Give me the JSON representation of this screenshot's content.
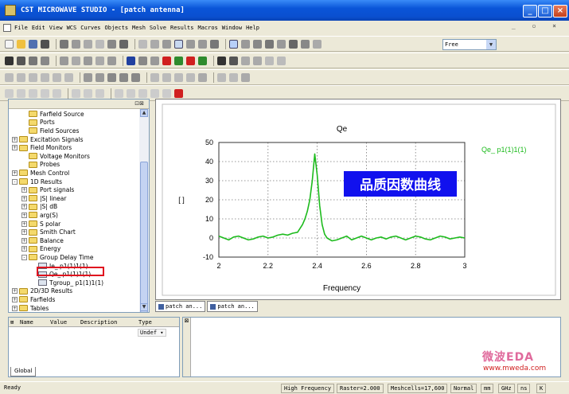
{
  "window": {
    "title": "CST MICROWAVE STUDIO - [patch antenna]"
  },
  "menu": [
    "File",
    "Edit",
    "View",
    "WCS",
    "Curves",
    "Objects",
    "Mesh",
    "Solve",
    "Results",
    "Macros",
    "Window",
    "Help"
  ],
  "toolbar": {
    "solver_select": "Free"
  },
  "tree": {
    "items": [
      {
        "label": "Farfield Source",
        "indent": 1,
        "type": "folder",
        "exp": ""
      },
      {
        "label": "Ports",
        "indent": 1,
        "type": "folder",
        "exp": ""
      },
      {
        "label": "Field Sources",
        "indent": 1,
        "type": "folder",
        "exp": ""
      },
      {
        "label": "Excitation Signals",
        "indent": 0,
        "type": "folder",
        "exp": "+"
      },
      {
        "label": "Field Monitors",
        "indent": 0,
        "type": "folder",
        "exp": "+"
      },
      {
        "label": "Voltage Monitors",
        "indent": 1,
        "type": "folder",
        "exp": ""
      },
      {
        "label": "Probes",
        "indent": 1,
        "type": "folder",
        "exp": ""
      },
      {
        "label": "Mesh Control",
        "indent": 0,
        "type": "folder",
        "exp": "+"
      },
      {
        "label": "1D Results",
        "indent": 0,
        "type": "folder",
        "exp": "-"
      },
      {
        "label": "Port signals",
        "indent": 1,
        "type": "folder",
        "exp": "+"
      },
      {
        "label": "|S| linear",
        "indent": 1,
        "type": "folder",
        "exp": "+"
      },
      {
        "label": "|S| dB",
        "indent": 1,
        "type": "folder",
        "exp": "+"
      },
      {
        "label": "arg(S)",
        "indent": 1,
        "type": "folder",
        "exp": "+"
      },
      {
        "label": "S polar",
        "indent": 1,
        "type": "folder",
        "exp": "+"
      },
      {
        "label": "Smith Chart",
        "indent": 1,
        "type": "folder",
        "exp": "+"
      },
      {
        "label": "Balance",
        "indent": 1,
        "type": "folder",
        "exp": "+"
      },
      {
        "label": "Energy",
        "indent": 1,
        "type": "folder",
        "exp": "+"
      },
      {
        "label": "Group Delay Time",
        "indent": 1,
        "type": "folder",
        "exp": "-"
      },
      {
        "label": "Ie_ p1(1)1(1)",
        "indent": 2,
        "type": "result",
        "exp": ""
      },
      {
        "label": "Qe_ p1(1)1(1)",
        "indent": 2,
        "type": "result",
        "exp": ""
      },
      {
        "label": "Tgroup_ p1(1)1(1)",
        "indent": 2,
        "type": "result",
        "exp": ""
      },
      {
        "label": "2D/3D Results",
        "indent": 0,
        "type": "folder",
        "exp": "+"
      },
      {
        "label": "Farfields",
        "indent": 0,
        "type": "folder",
        "exp": "+"
      },
      {
        "label": "Tables",
        "indent": 0,
        "type": "folder",
        "exp": "+"
      }
    ]
  },
  "plot": {
    "annotation": "品质因数曲线"
  },
  "chart_data": {
    "type": "line",
    "title": "Qe",
    "xlabel": "Frequency",
    "ylabel": "[ ]",
    "xlim": [
      2,
      3
    ],
    "ylim": [
      -10,
      50
    ],
    "xticks": [
      2,
      2.2,
      2.4,
      2.6,
      2.8,
      3
    ],
    "yticks": [
      -10,
      0,
      10,
      20,
      30,
      40,
      50
    ],
    "grid": true,
    "legend": "top-right",
    "series": [
      {
        "name": "Qe_ p1(1)1(1)",
        "color": "#1dbb1d",
        "x": [
          2.0,
          2.02,
          2.04,
          2.06,
          2.08,
          2.1,
          2.12,
          2.14,
          2.16,
          2.18,
          2.2,
          2.22,
          2.24,
          2.26,
          2.28,
          2.3,
          2.32,
          2.34,
          2.35,
          2.36,
          2.37,
          2.38,
          2.39,
          2.4,
          2.41,
          2.42,
          2.43,
          2.44,
          2.46,
          2.48,
          2.5,
          2.52,
          2.54,
          2.56,
          2.58,
          2.6,
          2.62,
          2.64,
          2.66,
          2.68,
          2.7,
          2.72,
          2.74,
          2.76,
          2.78,
          2.8,
          2.82,
          2.84,
          2.86,
          2.88,
          2.9,
          2.92,
          2.94,
          2.96,
          2.98,
          3.0
        ],
        "y": [
          1,
          0,
          -1,
          0.5,
          1,
          0,
          -1,
          -0.5,
          0.5,
          1,
          0,
          0.5,
          1.5,
          2,
          1.5,
          2.5,
          3,
          7,
          10,
          14,
          20,
          30,
          44,
          33,
          17,
          7,
          2,
          0,
          -1.5,
          -1,
          0,
          1,
          -1,
          0,
          1,
          0,
          -1,
          0,
          0.5,
          -0.5,
          0.5,
          1,
          0,
          -1,
          0,
          1,
          0.5,
          -0.5,
          -1,
          0,
          1,
          0.5,
          -0.5,
          0,
          0.5,
          0
        ]
      }
    ]
  },
  "doc_tabs": [
    "patch an...",
    "patch an..."
  ],
  "params": {
    "headers": [
      "Name",
      "Value",
      "Description",
      "Type"
    ],
    "type_value": "Undef",
    "tab": "Global"
  },
  "watermark": {
    "cn": "微波EDA",
    "url": "www.mweda.com"
  },
  "status": [
    "Ready",
    "High Frequency",
    "Raster=2.000",
    "Meshcells=17,600",
    "Normal",
    "mm",
    "GHz",
    "ns",
    "K"
  ]
}
